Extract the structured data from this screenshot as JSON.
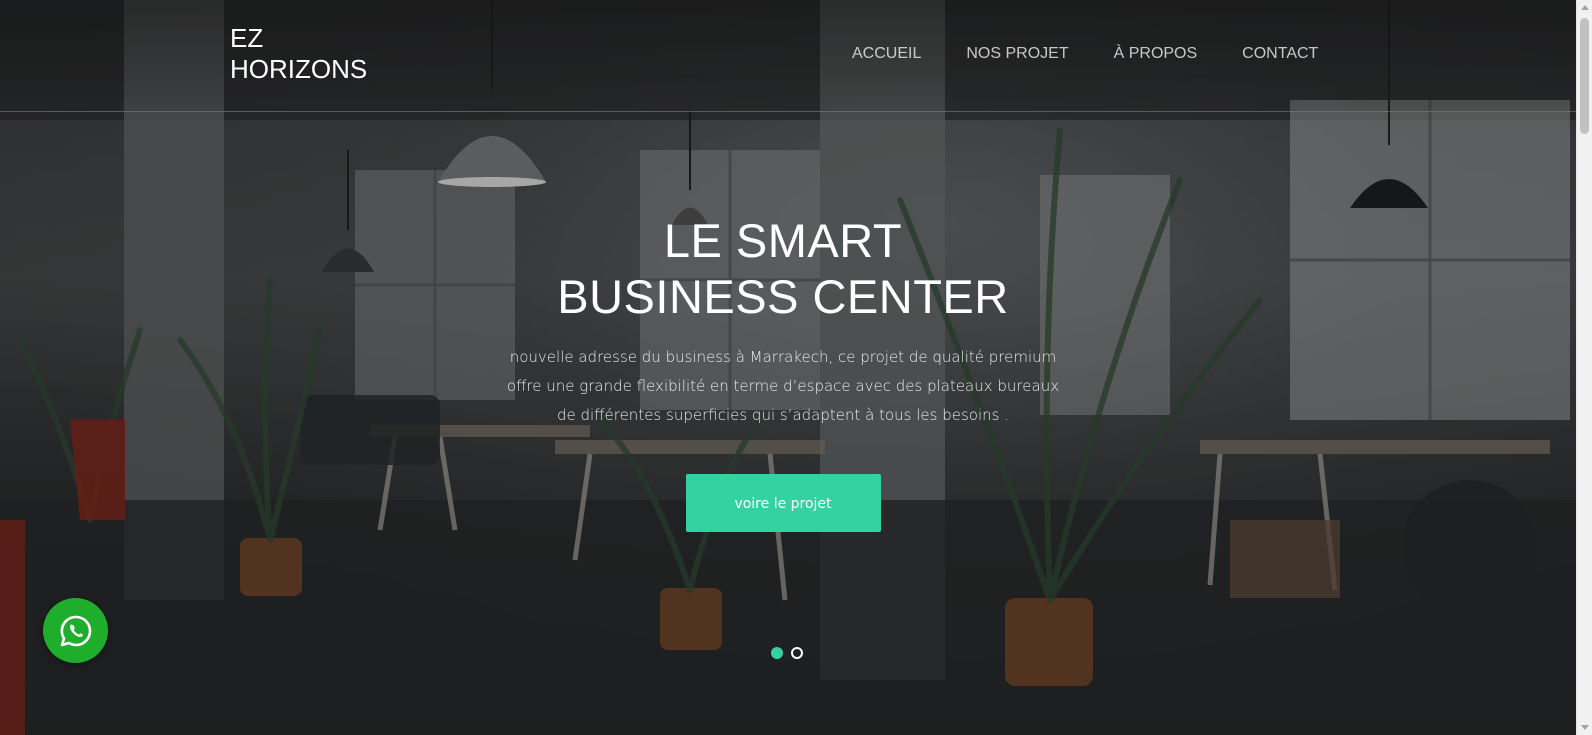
{
  "header": {
    "logo_line1": "EZ",
    "logo_line2": "HORIZONS",
    "nav": [
      {
        "label": "ACCUEIL"
      },
      {
        "label": "NOS PROJET"
      },
      {
        "label": "À PROPOS"
      },
      {
        "label": "CONTACT"
      }
    ]
  },
  "hero": {
    "title": "LE SMART BUSINESS CENTER",
    "text": "nouvelle adresse du business à Marrakech, ce projet de qualité premium offre une grande flexibilité en terme d’espace avec des plateaux bureaux de différentes superficies qui s’adaptent à tous les besoins .",
    "cta_label": "voire le projet",
    "slides": {
      "count": 2,
      "active_index": 0
    }
  },
  "colors": {
    "accent": "#34d1a1",
    "whatsapp": "#1fae2c"
  },
  "icons": {
    "chat": "whatsapp-icon"
  }
}
